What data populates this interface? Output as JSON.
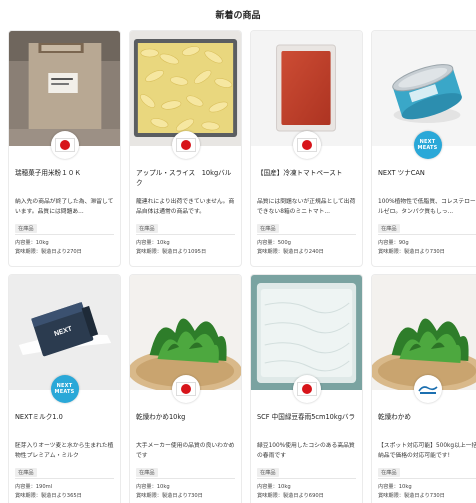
{
  "section": {
    "title": "新着の商品"
  },
  "products": [
    {
      "name": "瑞穂菓子用米粉１０Ｋ",
      "description": "納入先の商品が終了した為、滞留しています。品質には問題あ...",
      "stock": "在庫品",
      "content": "内容量：10kg",
      "expiry": "賞味期限：製造日より270日",
      "badge": "japan-flag-icon",
      "image_icon": "rice-flour-bag-icon"
    },
    {
      "name": "アップル・スライス　10kgバルク",
      "description": "籠連れにより出荷できていません。商品自体は通常の商品です。",
      "stock": "在庫品",
      "content": "内容量：10kg",
      "expiry": "賞味期限：製造日より1095日",
      "badge": "japan-flag-icon",
      "image_icon": "apple-slices-icon"
    },
    {
      "name": "【国産】冷凍トマトペースト",
      "description": "品質には問題ないが正規品として出荷できない8箱のミニトマト...",
      "stock": "在庫品",
      "content": "内容量：500g",
      "expiry": "賞味期限：製造日より240日",
      "badge": "japan-flag-icon",
      "image_icon": "tomato-paste-pack-icon"
    },
    {
      "name": "NEXT ツナCAN",
      "description": "100%植物性で低脂質、コレステロールゼロ。タンパク質もしっ...",
      "stock": "在庫品",
      "content": "内容量：90g",
      "expiry": "賞味期限：製造日より730日",
      "badge": "next-meats-logo-icon",
      "badge_text": "NEXT\nMEATS",
      "image_icon": "tuna-can-icon"
    },
    {
      "name": "NEXTミルク1.0",
      "description": "胚芽入りオーツ麦と水から生まれた植物性プレミアム・ミルク",
      "stock": "在庫品",
      "content": "内容量：190ml",
      "expiry": "賞味期限：製造日より365日",
      "badge": "next-meats-logo-icon",
      "badge_text": "NEXT\nMEATS",
      "image_icon": "milk-carton-icon"
    },
    {
      "name": "乾燥わかめ10kg",
      "description": "大手メーカー使用の品質の良いわかめです",
      "stock": "在庫品",
      "content": "内容量：10kg",
      "expiry": "賞味期限：製造日より730日",
      "badge": "japan-flag-icon",
      "image_icon": "wakame-seaweed-icon"
    },
    {
      "name": "SCF 中国緑豆春雨5cm10kgバラ",
      "description": "緑豆100%使用したコシのある高品質の春雨です",
      "stock": "在庫品",
      "content": "内容量：10kg",
      "expiry": "賞味期限：製造日より690日",
      "badge": "japan-flag-icon",
      "image_icon": "glass-noodles-bag-icon"
    },
    {
      "name": "乾燥わかめ",
      "description": "【スポット対応可能】500kg以上一括納品で価格の対応可能です!",
      "stock": "在庫品",
      "content": "内容量：10kg",
      "expiry": "賞味期限：製造日より730日",
      "badge": "company-logo-icon",
      "image_icon": "wakame-seaweed-icon"
    }
  ],
  "colors": {
    "japan_red": "#d7141a",
    "next_meats_blue": "#2aa8d8",
    "tag_bg": "#eeeeee",
    "card_border": "#ebebeb"
  }
}
